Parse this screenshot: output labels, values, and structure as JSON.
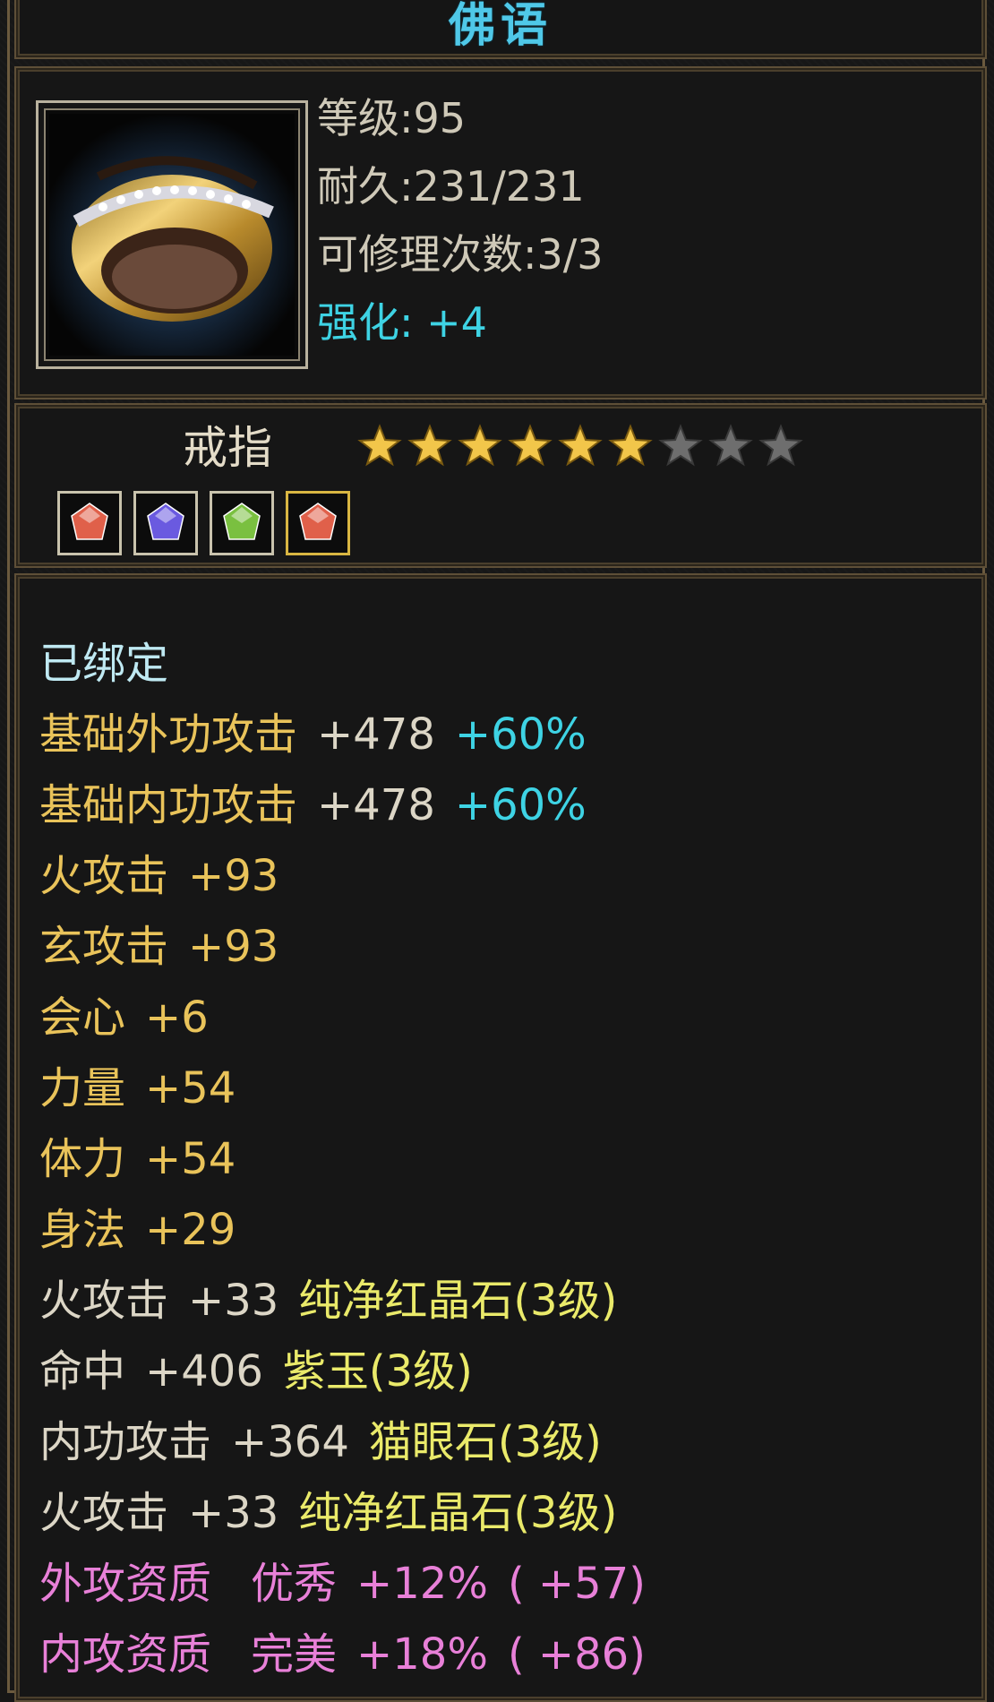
{
  "title": "佛语",
  "icon": "gold-ring-icon",
  "stats": {
    "level": "等级:95",
    "durability": "耐久:231/231",
    "repair": "可修理次数:3/3",
    "enhance": "强化: +4"
  },
  "item_type": "戒指",
  "stars": {
    "filled": 6,
    "total": 9
  },
  "gems": [
    {
      "icon": "red-gem-icon",
      "color": "#e0604a"
    },
    {
      "icon": "purple-gem-icon",
      "color": "#6a5ae0"
    },
    {
      "icon": "green-gem-icon",
      "color": "#7ac040"
    },
    {
      "icon": "red-gem-icon",
      "color": "#e0604a"
    }
  ],
  "attributes": {
    "bound": "已绑定",
    "l1": {
      "name": "基础外功攻击",
      "value": "+478",
      "bonus": "+60%"
    },
    "l2": {
      "name": "基础内功攻击",
      "value": "+478",
      "bonus": "+60%"
    },
    "l3": {
      "name": "火攻击",
      "value": "+93"
    },
    "l4": {
      "name": "玄攻击",
      "value": "+93"
    },
    "l5": {
      "name": "会心",
      "value": "+6"
    },
    "l6": {
      "name": "力量",
      "value": "+54"
    },
    "l7": {
      "name": "体力",
      "value": "+54"
    },
    "l8": {
      "name": "身法",
      "value": "+29"
    },
    "l9": {
      "name": "火攻击",
      "value": "+33",
      "gem": "纯净红晶石(3级)"
    },
    "l10": {
      "name": "命中",
      "value": "+406",
      "gem": "紫玉(3级)"
    },
    "l11": {
      "name": "内功攻击",
      "value": "+364",
      "gem": "猫眼石(3级)"
    },
    "l12": {
      "name": "火攻击",
      "value": "+33",
      "gem": "纯净红晶石(3级)"
    },
    "l13": {
      "name": "外攻资质",
      "grade": "优秀",
      "value": "+12%",
      "extra": "( +57)"
    },
    "l14": {
      "name": "内攻资质",
      "grade": "完美",
      "value": "+18%",
      "extra": "( +86)"
    }
  }
}
